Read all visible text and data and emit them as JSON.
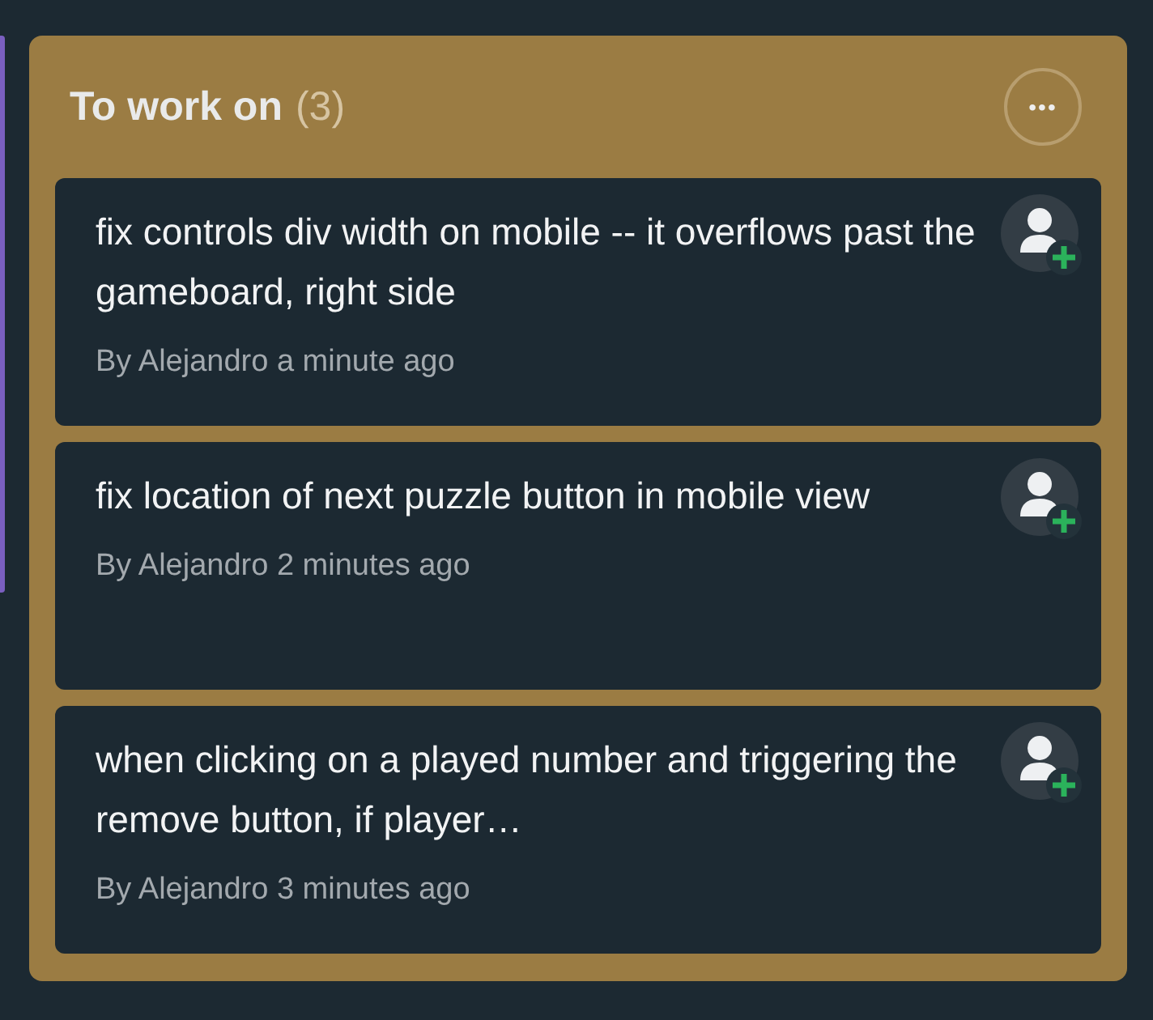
{
  "column": {
    "title": "To work on",
    "count": "(3)",
    "menu_button": "•••"
  },
  "cards": [
    {
      "title": "fix controls div width on mobile -- it overflows past the gameboard, right side",
      "meta": "By Alejandro a minute ago"
    },
    {
      "title": "fix location of next puzzle button in mobile view",
      "meta": "By Alejandro 2 minutes ago"
    },
    {
      "title": "when clicking on a played number and triggering the remove button, if player…",
      "meta": "By Alejandro 3 minutes ago"
    }
  ]
}
